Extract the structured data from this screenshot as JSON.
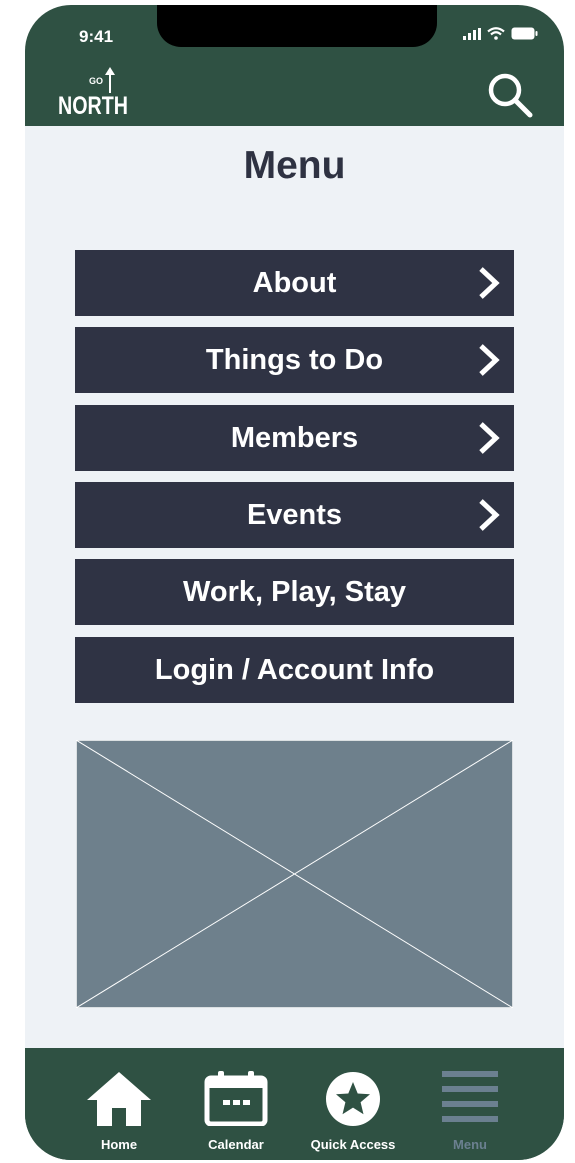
{
  "status_bar": {
    "time": "9:41"
  },
  "header": {
    "logo_small": "GO",
    "logo_text": "NORTH",
    "search_icon": "search-icon"
  },
  "page": {
    "title": "Menu"
  },
  "menu": [
    {
      "label": "About",
      "has_chevron": true
    },
    {
      "label": "Things to Do",
      "has_chevron": true
    },
    {
      "label": "Members",
      "has_chevron": true
    },
    {
      "label": "Events",
      "has_chevron": true
    },
    {
      "label": "Work, Play, Stay",
      "has_chevron": false
    },
    {
      "label": "Login / Account Info",
      "has_chevron": false
    }
  ],
  "tabbar": [
    {
      "label": "Home",
      "icon": "home-icon",
      "active": false
    },
    {
      "label": "Calendar",
      "icon": "calendar-icon",
      "active": false
    },
    {
      "label": "Quick Access",
      "icon": "star-circle-icon",
      "active": false
    },
    {
      "label": "Menu",
      "icon": "hamburger-icon",
      "active": true
    }
  ],
  "colors": {
    "brand_green": "#2f5143",
    "button_dark": "#2f3344",
    "background": "#eef2f6",
    "placeholder": "#6e808c",
    "menu_tab_dim": "#6b8090"
  }
}
